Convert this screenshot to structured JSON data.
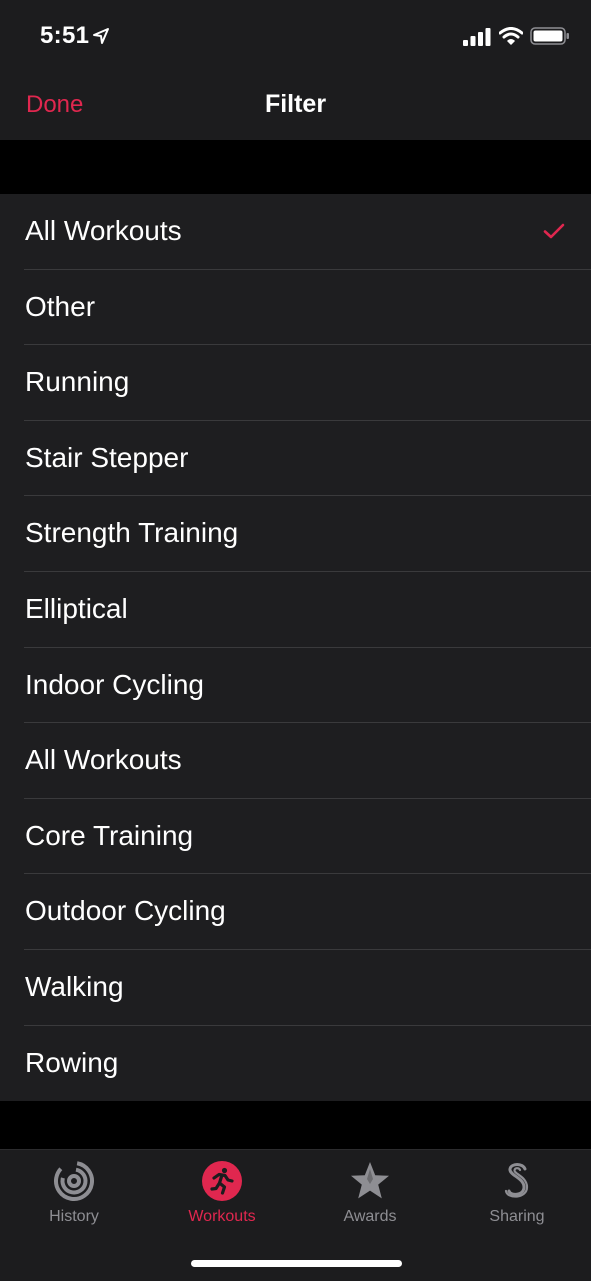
{
  "status_bar": {
    "time": "5:51"
  },
  "nav": {
    "done_label": "Done",
    "title": "Filter"
  },
  "filters": {
    "selected_index": 0,
    "items": [
      "All Workouts",
      "Other",
      "Running",
      "Stair Stepper",
      "Strength Training",
      "Elliptical",
      "Indoor Cycling",
      "All Workouts",
      "Core Training",
      "Outdoor Cycling",
      "Walking",
      "Rowing"
    ]
  },
  "tabs": [
    {
      "label": "History",
      "icon": "history-icon",
      "active": false
    },
    {
      "label": "Workouts",
      "icon": "runner-icon",
      "active": true
    },
    {
      "label": "Awards",
      "icon": "star-award-icon",
      "active": false
    },
    {
      "label": "Sharing",
      "icon": "sharing-icon",
      "active": false
    }
  ],
  "colors": {
    "accent": "#e0274f",
    "background": "#000000",
    "row_bg": "#1e1e20",
    "bar_bg": "#1c1c1e",
    "inactive": "#8e8e93"
  }
}
